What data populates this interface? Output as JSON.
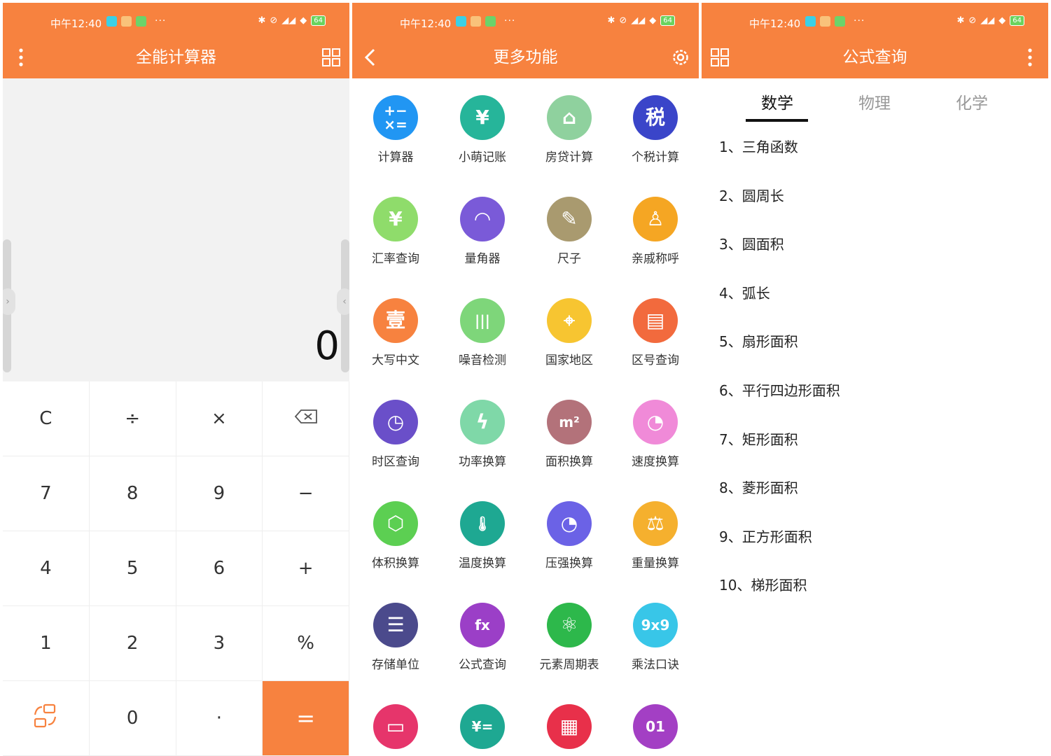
{
  "status": {
    "time": "中午12:40",
    "battery": "64"
  },
  "colors": {
    "accent": "#f7823f"
  },
  "calculator": {
    "title": "全能计算器",
    "display": "0",
    "keys": [
      {
        "label": "C",
        "icon": ""
      },
      {
        "label": "÷",
        "icon": ""
      },
      {
        "label": "×",
        "icon": ""
      },
      {
        "label": "",
        "icon": "backspace-icon"
      },
      {
        "label": "7",
        "icon": ""
      },
      {
        "label": "8",
        "icon": ""
      },
      {
        "label": "9",
        "icon": ""
      },
      {
        "label": "−",
        "icon": ""
      },
      {
        "label": "4",
        "icon": ""
      },
      {
        "label": "5",
        "icon": ""
      },
      {
        "label": "6",
        "icon": ""
      },
      {
        "label": "+",
        "icon": ""
      },
      {
        "label": "1",
        "icon": ""
      },
      {
        "label": "2",
        "icon": ""
      },
      {
        "label": "3",
        "icon": ""
      },
      {
        "label": "%",
        "icon": ""
      },
      {
        "label": "",
        "icon": "switch-icon"
      },
      {
        "label": "0",
        "icon": ""
      },
      {
        "label": "·",
        "icon": ""
      },
      {
        "label": "=",
        "icon": ""
      }
    ]
  },
  "more": {
    "title": "更多功能",
    "items": [
      {
        "label": "计算器",
        "glyph": "+−\n×=",
        "icon": "calculator-icon",
        "color": "#2196f3"
      },
      {
        "label": "小萌记账",
        "glyph": "¥",
        "icon": "ledger-icon",
        "color": "#26b59a"
      },
      {
        "label": "房贷计算",
        "glyph": "⌂",
        "icon": "house-icon",
        "color": "#8fd19e"
      },
      {
        "label": "个税计算",
        "glyph": "税",
        "icon": "tax-icon",
        "color": "#3a45c9"
      },
      {
        "label": "汇率查询",
        "glyph": "¥",
        "icon": "exchange-icon",
        "color": "#8fdc6b"
      },
      {
        "label": "量角器",
        "glyph": "◠",
        "icon": "protractor-icon",
        "color": "#7a5ad8"
      },
      {
        "label": "尺子",
        "glyph": "✎",
        "icon": "ruler-icon",
        "color": "#a99a6f"
      },
      {
        "label": "亲戚称呼",
        "glyph": "♙",
        "icon": "relative-icon",
        "color": "#f5a623"
      },
      {
        "label": "大写中文",
        "glyph": "壹",
        "icon": "chinese-number-icon",
        "color": "#f7823f"
      },
      {
        "label": "噪音检测",
        "glyph": "|||",
        "icon": "noise-icon",
        "color": "#7ed67a"
      },
      {
        "label": "国家地区",
        "glyph": "⌖",
        "icon": "location-icon",
        "color": "#f7c531"
      },
      {
        "label": "区号查询",
        "glyph": "▤",
        "icon": "area-code-icon",
        "color": "#f26a3d"
      },
      {
        "label": "时区查询",
        "glyph": "◷",
        "icon": "timezone-icon",
        "color": "#6a4fc9"
      },
      {
        "label": "功率换算",
        "glyph": "ϟ",
        "icon": "power-icon",
        "color": "#7fd8a8"
      },
      {
        "label": "面积换算",
        "glyph": "m²",
        "icon": "area-icon",
        "color": "#b3727a"
      },
      {
        "label": "速度换算",
        "glyph": "◔",
        "icon": "speed-icon",
        "color": "#f08ad8"
      },
      {
        "label": "体积换算",
        "glyph": "⬡",
        "icon": "volume-icon",
        "color": "#5ccf52"
      },
      {
        "label": "温度换算",
        "glyph": "🌡",
        "icon": "thermometer-icon",
        "color": "#1ea892"
      },
      {
        "label": "压强换算",
        "glyph": "◔",
        "icon": "pressure-icon",
        "color": "#6b62e6"
      },
      {
        "label": "重量换算",
        "glyph": "⚖",
        "icon": "weight-icon",
        "color": "#f5b02e"
      },
      {
        "label": "存储单位",
        "glyph": "☰",
        "icon": "storage-icon",
        "color": "#4b4a8c"
      },
      {
        "label": "公式查询",
        "glyph": "fx",
        "icon": "formula-icon",
        "color": "#9b3fc7"
      },
      {
        "label": "元素周期表",
        "glyph": "⚛",
        "icon": "periodic-table-icon",
        "color": "#2db84b"
      },
      {
        "label": "乘法口诀",
        "glyph": "9x9",
        "icon": "multiplication-icon",
        "color": "#38c6e8"
      },
      {
        "label": "",
        "glyph": "▭",
        "icon": "ruler-bar-icon",
        "color": "#e6356b"
      },
      {
        "label": "",
        "glyph": "¥=",
        "icon": "tax-list-icon",
        "color": "#1ea892"
      },
      {
        "label": "",
        "glyph": "▦",
        "icon": "calendar-icon",
        "color": "#e8304a"
      },
      {
        "label": "",
        "glyph": "01",
        "icon": "binary-icon",
        "color": "#a33fc4"
      }
    ]
  },
  "formula": {
    "title": "公式查询",
    "tabs": [
      "数学",
      "物理",
      "化学"
    ],
    "items": [
      "1、三角函数",
      "2、圆周长",
      "3、圆面积",
      "4、弧长",
      "5、扇形面积",
      "6、平行四边形面积",
      "7、矩形面积",
      "8、菱形面积",
      "9、正方形面积",
      "10、梯形面积"
    ]
  }
}
